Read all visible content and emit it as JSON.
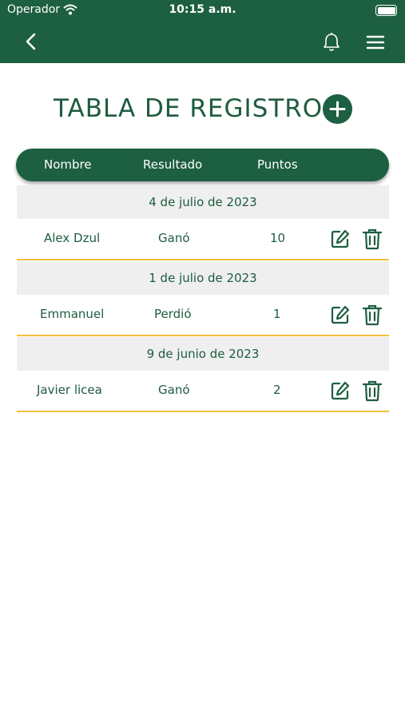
{
  "status_bar": {
    "carrier": "Operador",
    "time": "10:15 a.m."
  },
  "nav": {
    "back_icon": "chevron-left-icon",
    "bell_icon": "bell-icon",
    "menu_icon": "hamburger-menu-icon"
  },
  "page": {
    "title": "TABLA DE REGISTRO",
    "add_icon": "plus-icon"
  },
  "table": {
    "headers": {
      "nombre": "Nombre",
      "resultado": "Resultado",
      "puntos": "Puntos"
    },
    "groups": [
      {
        "date": "4 de julio de 2023",
        "nombre": "Alex Dzul",
        "resultado": "Ganó",
        "puntos": "10"
      },
      {
        "date": "1 de julio de 2023",
        "nombre": "Emmanuel",
        "resultado": "Perdió",
        "puntos": "1"
      },
      {
        "date": "9 de junio de 2023",
        "nombre": "Javier licea",
        "resultado": "Ganó",
        "puntos": "2"
      }
    ],
    "row_actions": {
      "edit_icon": "edit-icon",
      "delete_icon": "trash-icon"
    }
  },
  "colors": {
    "primary": "#1d5f41",
    "accent_border": "#f4bf3c",
    "date_row_bg": "#efefef"
  }
}
